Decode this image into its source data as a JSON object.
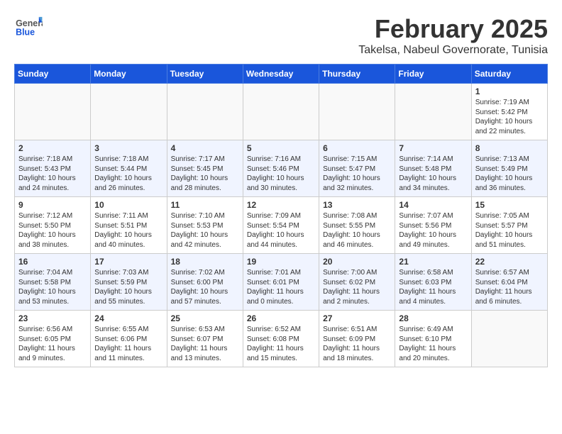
{
  "header": {
    "logo_general": "General",
    "logo_blue": "Blue",
    "title": "February 2025",
    "subtitle": "Takelsa, Nabeul Governorate, Tunisia"
  },
  "weekdays": [
    "Sunday",
    "Monday",
    "Tuesday",
    "Wednesday",
    "Thursday",
    "Friday",
    "Saturday"
  ],
  "weeks": [
    [
      {
        "day": "",
        "info": ""
      },
      {
        "day": "",
        "info": ""
      },
      {
        "day": "",
        "info": ""
      },
      {
        "day": "",
        "info": ""
      },
      {
        "day": "",
        "info": ""
      },
      {
        "day": "",
        "info": ""
      },
      {
        "day": "1",
        "info": "Sunrise: 7:19 AM\nSunset: 5:42 PM\nDaylight: 10 hours\nand 22 minutes."
      }
    ],
    [
      {
        "day": "2",
        "info": "Sunrise: 7:18 AM\nSunset: 5:43 PM\nDaylight: 10 hours\nand 24 minutes."
      },
      {
        "day": "3",
        "info": "Sunrise: 7:18 AM\nSunset: 5:44 PM\nDaylight: 10 hours\nand 26 minutes."
      },
      {
        "day": "4",
        "info": "Sunrise: 7:17 AM\nSunset: 5:45 PM\nDaylight: 10 hours\nand 28 minutes."
      },
      {
        "day": "5",
        "info": "Sunrise: 7:16 AM\nSunset: 5:46 PM\nDaylight: 10 hours\nand 30 minutes."
      },
      {
        "day": "6",
        "info": "Sunrise: 7:15 AM\nSunset: 5:47 PM\nDaylight: 10 hours\nand 32 minutes."
      },
      {
        "day": "7",
        "info": "Sunrise: 7:14 AM\nSunset: 5:48 PM\nDaylight: 10 hours\nand 34 minutes."
      },
      {
        "day": "8",
        "info": "Sunrise: 7:13 AM\nSunset: 5:49 PM\nDaylight: 10 hours\nand 36 minutes."
      }
    ],
    [
      {
        "day": "9",
        "info": "Sunrise: 7:12 AM\nSunset: 5:50 PM\nDaylight: 10 hours\nand 38 minutes."
      },
      {
        "day": "10",
        "info": "Sunrise: 7:11 AM\nSunset: 5:51 PM\nDaylight: 10 hours\nand 40 minutes."
      },
      {
        "day": "11",
        "info": "Sunrise: 7:10 AM\nSunset: 5:53 PM\nDaylight: 10 hours\nand 42 minutes."
      },
      {
        "day": "12",
        "info": "Sunrise: 7:09 AM\nSunset: 5:54 PM\nDaylight: 10 hours\nand 44 minutes."
      },
      {
        "day": "13",
        "info": "Sunrise: 7:08 AM\nSunset: 5:55 PM\nDaylight: 10 hours\nand 46 minutes."
      },
      {
        "day": "14",
        "info": "Sunrise: 7:07 AM\nSunset: 5:56 PM\nDaylight: 10 hours\nand 49 minutes."
      },
      {
        "day": "15",
        "info": "Sunrise: 7:05 AM\nSunset: 5:57 PM\nDaylight: 10 hours\nand 51 minutes."
      }
    ],
    [
      {
        "day": "16",
        "info": "Sunrise: 7:04 AM\nSunset: 5:58 PM\nDaylight: 10 hours\nand 53 minutes."
      },
      {
        "day": "17",
        "info": "Sunrise: 7:03 AM\nSunset: 5:59 PM\nDaylight: 10 hours\nand 55 minutes."
      },
      {
        "day": "18",
        "info": "Sunrise: 7:02 AM\nSunset: 6:00 PM\nDaylight: 10 hours\nand 57 minutes."
      },
      {
        "day": "19",
        "info": "Sunrise: 7:01 AM\nSunset: 6:01 PM\nDaylight: 11 hours\nand 0 minutes."
      },
      {
        "day": "20",
        "info": "Sunrise: 7:00 AM\nSunset: 6:02 PM\nDaylight: 11 hours\nand 2 minutes."
      },
      {
        "day": "21",
        "info": "Sunrise: 6:58 AM\nSunset: 6:03 PM\nDaylight: 11 hours\nand 4 minutes."
      },
      {
        "day": "22",
        "info": "Sunrise: 6:57 AM\nSunset: 6:04 PM\nDaylight: 11 hours\nand 6 minutes."
      }
    ],
    [
      {
        "day": "23",
        "info": "Sunrise: 6:56 AM\nSunset: 6:05 PM\nDaylight: 11 hours\nand 9 minutes."
      },
      {
        "day": "24",
        "info": "Sunrise: 6:55 AM\nSunset: 6:06 PM\nDaylight: 11 hours\nand 11 minutes."
      },
      {
        "day": "25",
        "info": "Sunrise: 6:53 AM\nSunset: 6:07 PM\nDaylight: 11 hours\nand 13 minutes."
      },
      {
        "day": "26",
        "info": "Sunrise: 6:52 AM\nSunset: 6:08 PM\nDaylight: 11 hours\nand 15 minutes."
      },
      {
        "day": "27",
        "info": "Sunrise: 6:51 AM\nSunset: 6:09 PM\nDaylight: 11 hours\nand 18 minutes."
      },
      {
        "day": "28",
        "info": "Sunrise: 6:49 AM\nSunset: 6:10 PM\nDaylight: 11 hours\nand 20 minutes."
      },
      {
        "day": "",
        "info": ""
      }
    ]
  ]
}
